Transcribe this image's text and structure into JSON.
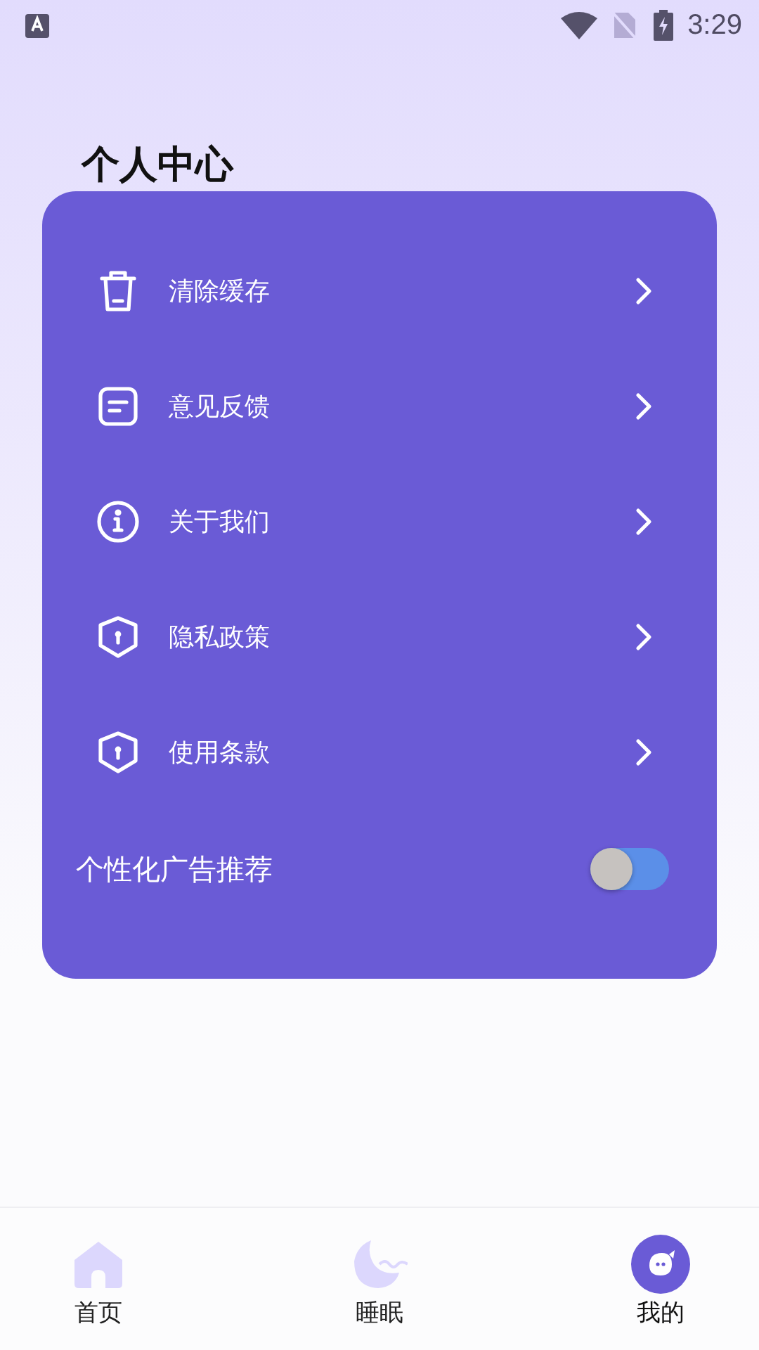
{
  "status_bar": {
    "time": "3:29"
  },
  "title": "个人中心",
  "menu": [
    {
      "label": "清除缓存",
      "kind": "trash"
    },
    {
      "label": "意见反馈",
      "kind": "note"
    },
    {
      "label": "关于我们",
      "kind": "info"
    },
    {
      "label": "隐私政策",
      "kind": "shield"
    },
    {
      "label": "使用条款",
      "kind": "shield"
    }
  ],
  "ad_setting": {
    "label": "个性化广告推荐",
    "on": false
  },
  "nav": [
    {
      "label": "首页",
      "kind": "home",
      "selected": false
    },
    {
      "label": "睡眠",
      "kind": "moon",
      "selected": false
    },
    {
      "label": "我的",
      "kind": "face",
      "selected": true
    }
  ]
}
